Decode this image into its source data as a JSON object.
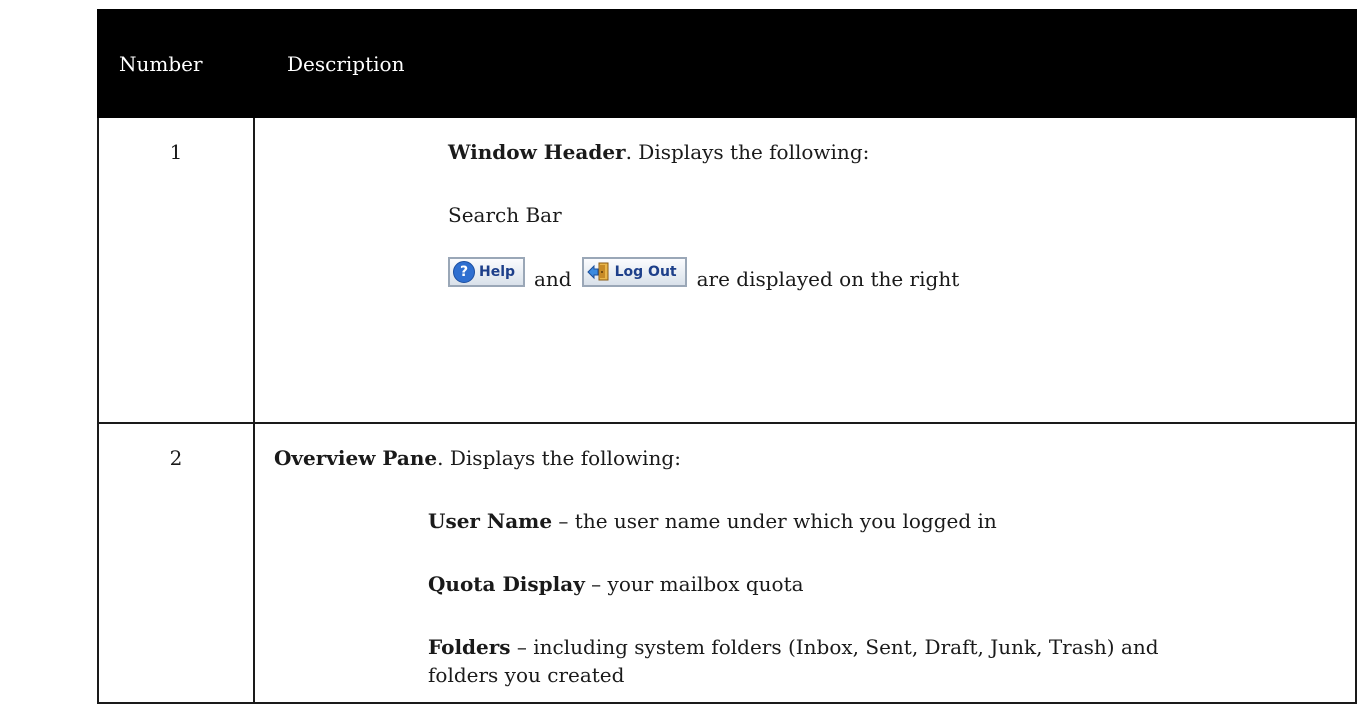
{
  "table": {
    "headers": {
      "number": "Number",
      "description": "Description"
    },
    "rows": [
      {
        "number": "1",
        "title": "Window Header",
        "title_suffix": ". Displays the following:",
        "item_search": "Search Bar",
        "help_button": "Help",
        "and_word": "and",
        "logout_button": "Log Out",
        "buttons_suffix": "are displayed on the right"
      },
      {
        "number": "2",
        "title": "Overview Pane",
        "title_suffix": ". Displays the following:",
        "items": [
          {
            "term": "User Name",
            "desc": " – the user name under which you logged in"
          },
          {
            "term": "Quota Display",
            "desc": " – your mailbox quota"
          },
          {
            "term": "Folders",
            "desc": " – including system folders (Inbox, Sent, Draft, Junk, Trash) and folders you created"
          }
        ]
      }
    ]
  },
  "icons": {
    "help": "help-question-icon",
    "logout": "logout-door-icon"
  }
}
